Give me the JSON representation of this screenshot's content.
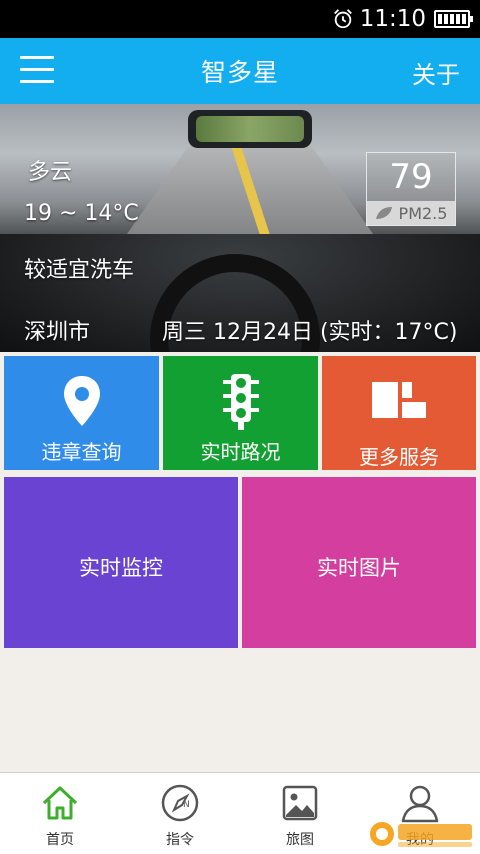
{
  "status_bar": {
    "time": "11:10"
  },
  "header": {
    "title": "智多星",
    "about_label": "关于"
  },
  "banner": {
    "weather": "多云",
    "temperature": "19 ~ 14°C",
    "car_wash": "较适宜洗车",
    "city": "深圳市",
    "date": "周三 12月24日 (实时：17°C)",
    "pm_value": "79",
    "pm_label": "PM2.5"
  },
  "tiles": [
    {
      "label": "违章查询",
      "color": "#2f8ce8",
      "icon": "location-pin-icon"
    },
    {
      "label": "实时路况",
      "color": "#13a032",
      "icon": "traffic-light-icon"
    },
    {
      "label": "更多服务",
      "color": "#e45a34",
      "icon": "more-services-icon"
    },
    {
      "label": "实时监控",
      "color": "#6a43d3"
    },
    {
      "label": "实时图片",
      "color": "#d43f9f"
    }
  ],
  "tabbar": {
    "items": [
      {
        "label": "首页",
        "icon": "home-icon",
        "active": true
      },
      {
        "label": "指令",
        "icon": "compass-icon"
      },
      {
        "label": "旅图",
        "icon": "picture-icon"
      },
      {
        "label": "我的",
        "icon": "user-icon"
      }
    ]
  },
  "colors": {
    "header": "#13aef0",
    "active_tab": "#3dae2b"
  }
}
